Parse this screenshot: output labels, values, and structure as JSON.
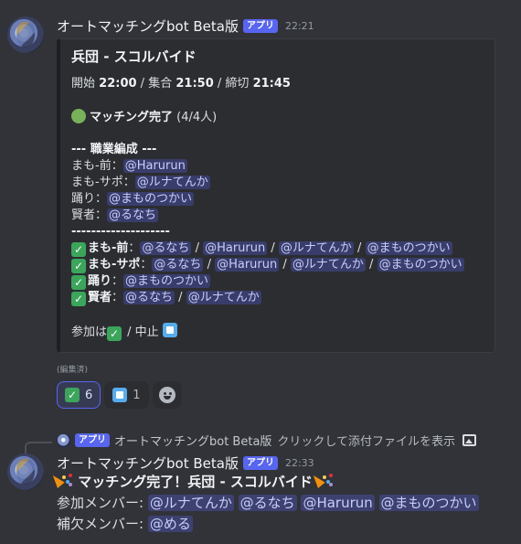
{
  "message1": {
    "username": "オートマッチングbot Beta版",
    "app_tag": "アプリ",
    "time": "22:21",
    "embed": {
      "title": "兵団 - スコルバイド",
      "schedule": {
        "start_label": "開始",
        "start_time": "22:00",
        "gather_label": "集合",
        "gather_time": "21:50",
        "deadline_label": "締切",
        "deadline_time": "21:45"
      },
      "status_text": "マッチング完了",
      "status_count": "(4/4人)",
      "composition_header": "--- 職業編成 ---",
      "roles": [
        {
          "role": "まも-前：",
          "member": "@Harurun"
        },
        {
          "role": "まも-サポ：",
          "member": "@ルナてんか"
        },
        {
          "role": "踊り：",
          "member": "@まものつかい"
        },
        {
          "role": "賢者：",
          "member": "@るなち"
        }
      ],
      "separator": "--------------------",
      "candidates": [
        {
          "role": "まも-前",
          "members": [
            "@るなち",
            "@Harurun",
            "@ルナてんか",
            "@まものつかい"
          ]
        },
        {
          "role": "まも-サポ",
          "members": [
            "@るなち",
            "@Harurun",
            "@ルナてんか",
            "@まものつかい"
          ]
        },
        {
          "role": "踊り",
          "members": [
            "@まものつかい"
          ]
        },
        {
          "role": "賢者",
          "members": [
            "@るなち",
            "@ルナてんか"
          ]
        }
      ],
      "join_label": "参加は",
      "cancel_label": "/ 中止"
    },
    "edited_label": "(編集済)",
    "reactions": [
      {
        "icon": "check-mark-icon",
        "count": "6",
        "active": true
      },
      {
        "icon": "white-square-icon",
        "count": "1",
        "active": false
      }
    ]
  },
  "reply": {
    "app_tag": "アプリ",
    "username": "オートマッチングbot Beta版",
    "preview_text": "クリックして添付ファイルを表示"
  },
  "message2": {
    "username": "オートマッチングbot Beta版",
    "app_tag": "アプリ",
    "time": "22:33",
    "headline": "マッチング完了！兵団 - スコルバイド",
    "participants_label": "参加メンバー:",
    "participants": [
      "@ルナてんか",
      "@るなち",
      "@Harurun",
      "@まものつかい"
    ],
    "reserve_label": "補欠メンバー:",
    "reserves": [
      "@める"
    ]
  },
  "colors": {
    "background": "#313338",
    "embed_background": "#2b2d31",
    "app_tag": "#5865f2",
    "mention_bg": "#3c4270",
    "check_green": "#3ba55c",
    "square_blue": "#55acee"
  }
}
